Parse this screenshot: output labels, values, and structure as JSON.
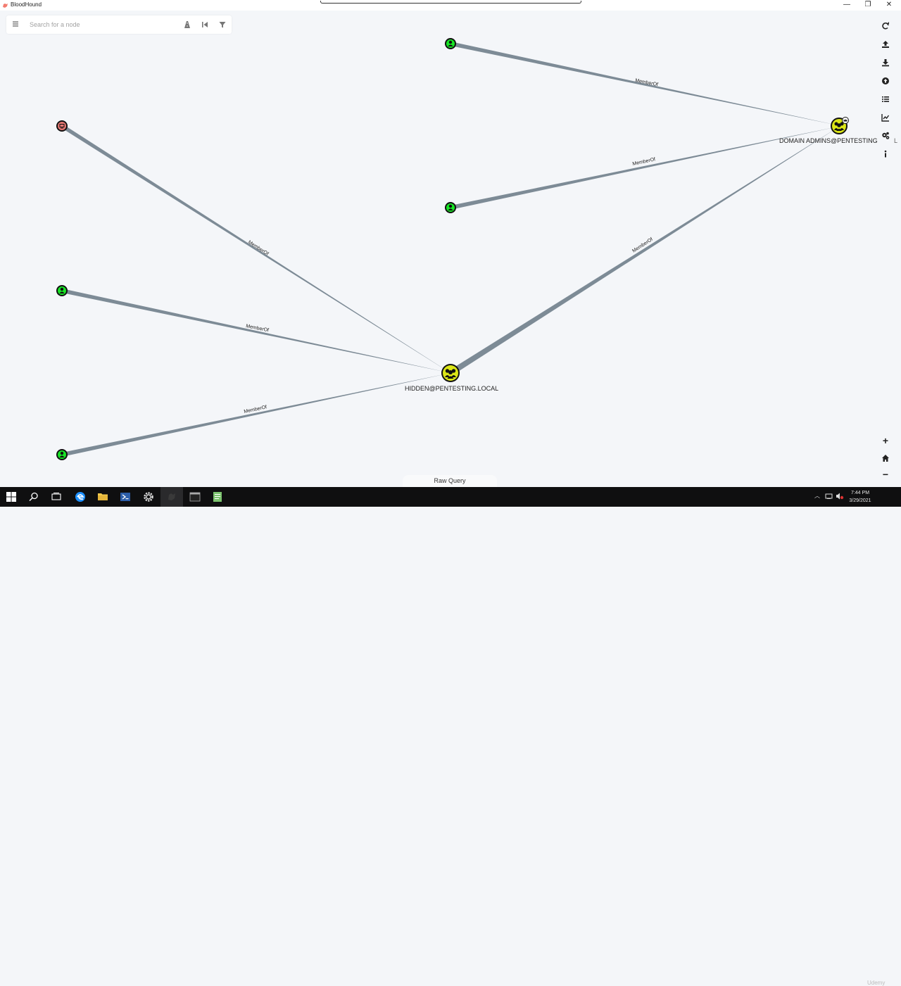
{
  "window": {
    "title": "BloodHound",
    "minimize": "—",
    "restore": "❐",
    "close": "✕"
  },
  "search": {
    "placeholder": "Search for a node"
  },
  "nodes": {
    "domain_admins": "DOMAIN ADMINS@PENTESTING",
    "domain_admins_overflow": "L",
    "hidden": "HIDDEN@PENTESTING.LOCAL"
  },
  "edges": {
    "label": "MemberOf"
  },
  "toolbar": [
    {
      "name": "refresh-icon"
    },
    {
      "name": "export-icon"
    },
    {
      "name": "import-icon"
    },
    {
      "name": "upload-icon"
    },
    {
      "name": "queries-list-icon"
    },
    {
      "name": "chart-icon"
    },
    {
      "name": "settings-icon"
    },
    {
      "name": "info-icon"
    }
  ],
  "zoom": {
    "in": "+",
    "out": "−"
  },
  "raw_query": {
    "label": "Raw Query"
  },
  "taskbar": {
    "time": "7:44 PM",
    "date": "3/29/2021",
    "watermark": "Udemy"
  },
  "colors": {
    "user_node": "#17e625",
    "group_node": "#dbe617",
    "computer_node": "#e67873",
    "edge": "#7d8b96",
    "canvas": "#f4f6f9"
  }
}
